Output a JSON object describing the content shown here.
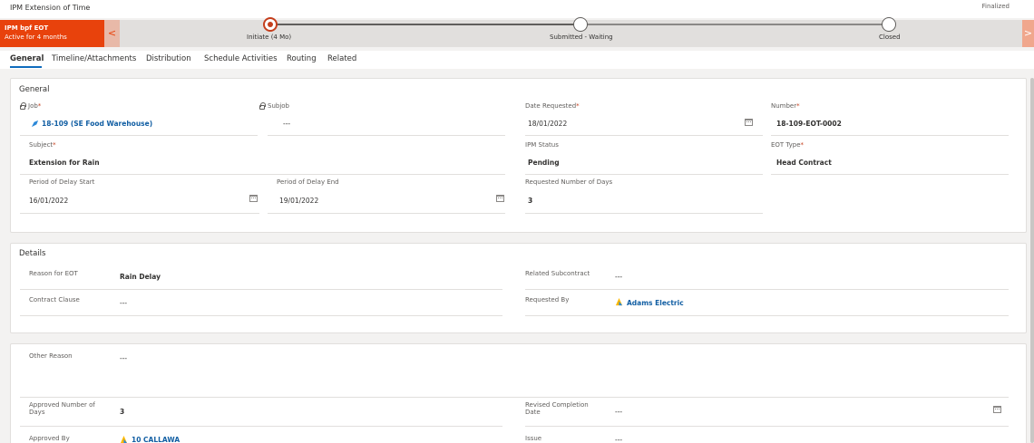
{
  "header": {
    "entity_title": "IPM Extension of Time",
    "status": "Finalized"
  },
  "bpf": {
    "process_name": "IPM bpf EOT",
    "process_duration": "Active for 4 months",
    "stages": [
      {
        "label": "Initiate  (4 Mo)",
        "active": true
      },
      {
        "label": "Submitted - Waiting",
        "active": false
      },
      {
        "label": "Closed",
        "active": false
      }
    ],
    "prev_glyph": "<",
    "next_glyph": ">"
  },
  "tabs": [
    "General",
    "Timeline/Attachments",
    "Distribution",
    "Schedule Activities",
    "Routing",
    "Related"
  ],
  "general": {
    "title": "General",
    "job_label": "Job",
    "job_value": "18-109 (SE Food Warehouse)",
    "subjob_label": "Subjob",
    "subjob_value": "---",
    "date_requested_label": "Date Requested",
    "date_requested_value": "18/01/2022",
    "number_label": "Number",
    "number_value": "18-109-EOT-0002",
    "subject_label": "Subject",
    "subject_value": "Extension for Rain",
    "ipm_status_label": "IPM Status",
    "ipm_status_value": "Pending",
    "eot_type_label": "EOT Type",
    "eot_type_value": "Head Contract",
    "delay_start_label": "Period of Delay Start",
    "delay_start_value": "16/01/2022",
    "delay_end_label": "Period of Delay End",
    "delay_end_value": "19/01/2022",
    "req_days_label": "Requested Number of Days",
    "req_days_value": "3",
    "required_mark": "*"
  },
  "details": {
    "title": "Details",
    "reason_label": "Reason for EOT",
    "reason_value": "Rain Delay",
    "related_sub_label": "Related Subcontract",
    "related_sub_value": "---",
    "clause_label": "Contract Clause",
    "clause_value": "---",
    "requested_by_label": "Requested By",
    "requested_by_value": "Adams Electric"
  },
  "other": {
    "other_reason_label": "Other Reason",
    "other_reason_value": "---",
    "approved_days_label_1": "Approved Number of",
    "approved_days_label_2": "Days",
    "approved_days_value": "3",
    "revised_label_1": "Revised Completion",
    "revised_label_2": "Date",
    "revised_value": "---",
    "approved_by_label": "Approved By",
    "approved_by_value": "10 CALLAWA",
    "issue_label": "Issue",
    "issue_value": "---"
  },
  "colors": {
    "accent": "#e8420c",
    "link": "#115ea3",
    "required": "#c43e1c"
  }
}
